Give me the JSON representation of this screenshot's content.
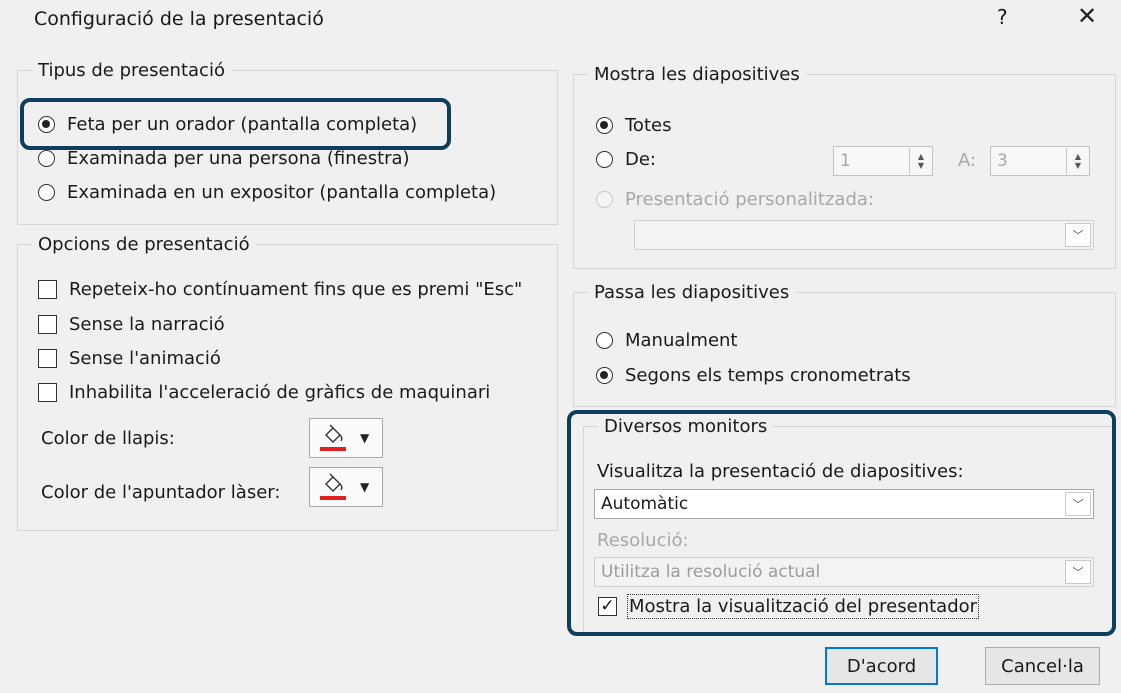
{
  "window": {
    "title": "Configuració de la presentació",
    "help_label": "?",
    "close_label": "✕"
  },
  "presentation_type": {
    "legend": "Tipus de presentació",
    "options": [
      {
        "label": "Feta per un orador (pantalla completa)",
        "checked": true
      },
      {
        "label": "Examinada per una persona (finestra)",
        "checked": false
      },
      {
        "label": "Examinada en un expositor (pantalla completa)",
        "checked": false
      }
    ]
  },
  "show_options": {
    "legend": "Opcions de presentació",
    "checkboxes": [
      {
        "label": "Repeteix-ho contínuament fins que es premi \"Esc\"",
        "checked": false
      },
      {
        "label": "Sense la narració",
        "checked": false
      },
      {
        "label": "Sense l'animació",
        "checked": false
      },
      {
        "label": "Inhabilita l'acceleració de gràfics de maquinari",
        "checked": false
      }
    ],
    "pen_color_label": "Color de llapis:",
    "laser_color_label": "Color de l'apuntador làser:",
    "pen_color": "#e02020",
    "laser_color": "#e02020"
  },
  "show_slides": {
    "legend": "Mostra les diapositives",
    "all_label": "Totes",
    "from_label": "De:",
    "from_value": "1",
    "to_label": "A:",
    "to_value": "3",
    "custom_label": "Presentació personalitzada:",
    "custom_value": ""
  },
  "advance_slides": {
    "legend": "Passa les diapositives",
    "manual_label": "Manualment",
    "timings_label": "Segons els temps cronometrats"
  },
  "multiple_monitors": {
    "legend": "Diversos monitors",
    "display_label": "Visualitza la presentació de diapositives:",
    "display_value": "Automàtic",
    "resolution_label": "Resolució:",
    "resolution_value": "Utilitza la resolució actual",
    "presenter_view_label": "Mostra la visualització del presentador",
    "presenter_view_checked": true
  },
  "buttons": {
    "ok": "D'acord",
    "cancel": "Cancel·la"
  },
  "colors": {
    "highlight": "#0f3d5c",
    "default_button_border": "#0078d7"
  }
}
